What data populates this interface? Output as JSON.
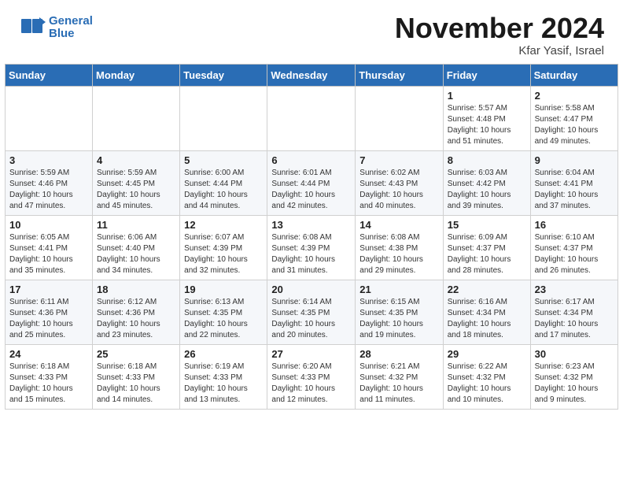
{
  "header": {
    "logo_line1": "General",
    "logo_line2": "Blue",
    "month": "November 2024",
    "location": "Kfar Yasif, Israel"
  },
  "weekdays": [
    "Sunday",
    "Monday",
    "Tuesday",
    "Wednesday",
    "Thursday",
    "Friday",
    "Saturday"
  ],
  "weeks": [
    [
      {
        "day": "",
        "info": ""
      },
      {
        "day": "",
        "info": ""
      },
      {
        "day": "",
        "info": ""
      },
      {
        "day": "",
        "info": ""
      },
      {
        "day": "",
        "info": ""
      },
      {
        "day": "1",
        "info": "Sunrise: 5:57 AM\nSunset: 4:48 PM\nDaylight: 10 hours\nand 51 minutes."
      },
      {
        "day": "2",
        "info": "Sunrise: 5:58 AM\nSunset: 4:47 PM\nDaylight: 10 hours\nand 49 minutes."
      }
    ],
    [
      {
        "day": "3",
        "info": "Sunrise: 5:59 AM\nSunset: 4:46 PM\nDaylight: 10 hours\nand 47 minutes."
      },
      {
        "day": "4",
        "info": "Sunrise: 5:59 AM\nSunset: 4:45 PM\nDaylight: 10 hours\nand 45 minutes."
      },
      {
        "day": "5",
        "info": "Sunrise: 6:00 AM\nSunset: 4:44 PM\nDaylight: 10 hours\nand 44 minutes."
      },
      {
        "day": "6",
        "info": "Sunrise: 6:01 AM\nSunset: 4:44 PM\nDaylight: 10 hours\nand 42 minutes."
      },
      {
        "day": "7",
        "info": "Sunrise: 6:02 AM\nSunset: 4:43 PM\nDaylight: 10 hours\nand 40 minutes."
      },
      {
        "day": "8",
        "info": "Sunrise: 6:03 AM\nSunset: 4:42 PM\nDaylight: 10 hours\nand 39 minutes."
      },
      {
        "day": "9",
        "info": "Sunrise: 6:04 AM\nSunset: 4:41 PM\nDaylight: 10 hours\nand 37 minutes."
      }
    ],
    [
      {
        "day": "10",
        "info": "Sunrise: 6:05 AM\nSunset: 4:41 PM\nDaylight: 10 hours\nand 35 minutes."
      },
      {
        "day": "11",
        "info": "Sunrise: 6:06 AM\nSunset: 4:40 PM\nDaylight: 10 hours\nand 34 minutes."
      },
      {
        "day": "12",
        "info": "Sunrise: 6:07 AM\nSunset: 4:39 PM\nDaylight: 10 hours\nand 32 minutes."
      },
      {
        "day": "13",
        "info": "Sunrise: 6:08 AM\nSunset: 4:39 PM\nDaylight: 10 hours\nand 31 minutes."
      },
      {
        "day": "14",
        "info": "Sunrise: 6:08 AM\nSunset: 4:38 PM\nDaylight: 10 hours\nand 29 minutes."
      },
      {
        "day": "15",
        "info": "Sunrise: 6:09 AM\nSunset: 4:37 PM\nDaylight: 10 hours\nand 28 minutes."
      },
      {
        "day": "16",
        "info": "Sunrise: 6:10 AM\nSunset: 4:37 PM\nDaylight: 10 hours\nand 26 minutes."
      }
    ],
    [
      {
        "day": "17",
        "info": "Sunrise: 6:11 AM\nSunset: 4:36 PM\nDaylight: 10 hours\nand 25 minutes."
      },
      {
        "day": "18",
        "info": "Sunrise: 6:12 AM\nSunset: 4:36 PM\nDaylight: 10 hours\nand 23 minutes."
      },
      {
        "day": "19",
        "info": "Sunrise: 6:13 AM\nSunset: 4:35 PM\nDaylight: 10 hours\nand 22 minutes."
      },
      {
        "day": "20",
        "info": "Sunrise: 6:14 AM\nSunset: 4:35 PM\nDaylight: 10 hours\nand 20 minutes."
      },
      {
        "day": "21",
        "info": "Sunrise: 6:15 AM\nSunset: 4:35 PM\nDaylight: 10 hours\nand 19 minutes."
      },
      {
        "day": "22",
        "info": "Sunrise: 6:16 AM\nSunset: 4:34 PM\nDaylight: 10 hours\nand 18 minutes."
      },
      {
        "day": "23",
        "info": "Sunrise: 6:17 AM\nSunset: 4:34 PM\nDaylight: 10 hours\nand 17 minutes."
      }
    ],
    [
      {
        "day": "24",
        "info": "Sunrise: 6:18 AM\nSunset: 4:33 PM\nDaylight: 10 hours\nand 15 minutes."
      },
      {
        "day": "25",
        "info": "Sunrise: 6:18 AM\nSunset: 4:33 PM\nDaylight: 10 hours\nand 14 minutes."
      },
      {
        "day": "26",
        "info": "Sunrise: 6:19 AM\nSunset: 4:33 PM\nDaylight: 10 hours\nand 13 minutes."
      },
      {
        "day": "27",
        "info": "Sunrise: 6:20 AM\nSunset: 4:33 PM\nDaylight: 10 hours\nand 12 minutes."
      },
      {
        "day": "28",
        "info": "Sunrise: 6:21 AM\nSunset: 4:32 PM\nDaylight: 10 hours\nand 11 minutes."
      },
      {
        "day": "29",
        "info": "Sunrise: 6:22 AM\nSunset: 4:32 PM\nDaylight: 10 hours\nand 10 minutes."
      },
      {
        "day": "30",
        "info": "Sunrise: 6:23 AM\nSunset: 4:32 PM\nDaylight: 10 hours\nand 9 minutes."
      }
    ]
  ]
}
